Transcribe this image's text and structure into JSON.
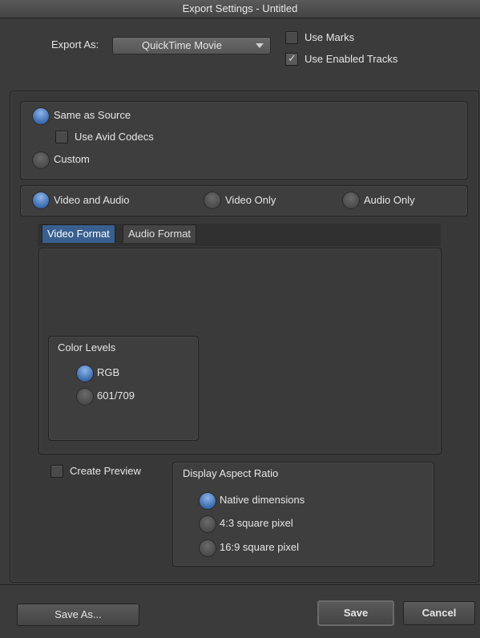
{
  "window": {
    "title": "Export Settings - Untitled"
  },
  "export": {
    "label": "Export As:",
    "selected": "QuickTime Movie",
    "use_marks": "Use Marks",
    "use_enabled_tracks": "Use Enabled Tracks",
    "use_marks_checked": false,
    "use_enabled_tracks_checked": true
  },
  "source": {
    "same_as_source": "Same as Source",
    "use_avid_codecs": "Use Avid Codecs",
    "custom": "Custom",
    "selected": "Same as Source"
  },
  "tracks": {
    "video_and_audio": "Video and Audio",
    "video_only": "Video Only",
    "audio_only": "Audio Only",
    "selected": "Video and Audio"
  },
  "tabs": [
    {
      "label": "Video Format",
      "active": true
    },
    {
      "label": "Audio Format",
      "active": false
    }
  ],
  "color_levels": {
    "title": "Color Levels",
    "rgb": "RGB",
    "601_709": "601/709",
    "selected": "RGB"
  },
  "create_preview": {
    "label": "Create Preview",
    "checked": false
  },
  "aspect": {
    "title": "Display Aspect Ratio",
    "native": "Native dimensions",
    "four_three": "4:3 square pixel",
    "sixteen_nine": "16:9 square pixel",
    "selected": "Native dimensions"
  },
  "buttons": {
    "save_as": "Save As...",
    "save": "Save",
    "cancel": "Cancel"
  },
  "colors": {
    "accent": "#385f8f",
    "background": "#3b3b3b",
    "radio_selected": "#3d6cae"
  }
}
